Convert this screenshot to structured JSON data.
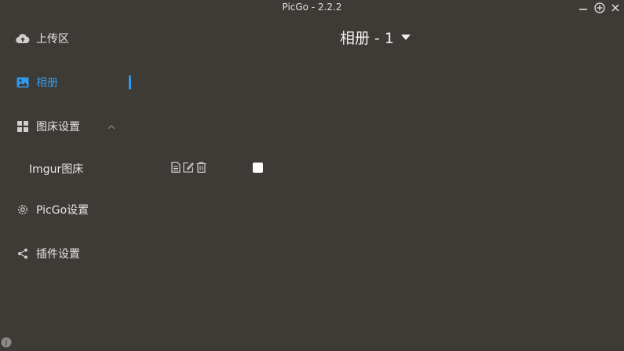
{
  "window": {
    "title": "PicGo - 2.2.2",
    "controls": [
      "minimize-icon",
      "maximize-icon",
      "close-icon"
    ]
  },
  "sidebar": {
    "items": [
      {
        "label": "上传区",
        "icon": "cloud-upload-icon"
      },
      {
        "label": "相册",
        "icon": "picture-icon",
        "active": true
      },
      {
        "label": "图床设置",
        "icon": "grid-icon",
        "expanded": true
      },
      {
        "label": "PicGo设置",
        "icon": "gear-icon"
      },
      {
        "label": "插件设置",
        "icon": "share-icon"
      }
    ],
    "submenu": {
      "label": "Imgur图床",
      "actions": [
        "document-icon",
        "edit-icon",
        "trash-icon"
      ],
      "checked": false
    }
  },
  "main": {
    "title": "相册 - 1"
  },
  "colors": {
    "background": "#3e3a36",
    "accent": "#2d9cf0"
  }
}
